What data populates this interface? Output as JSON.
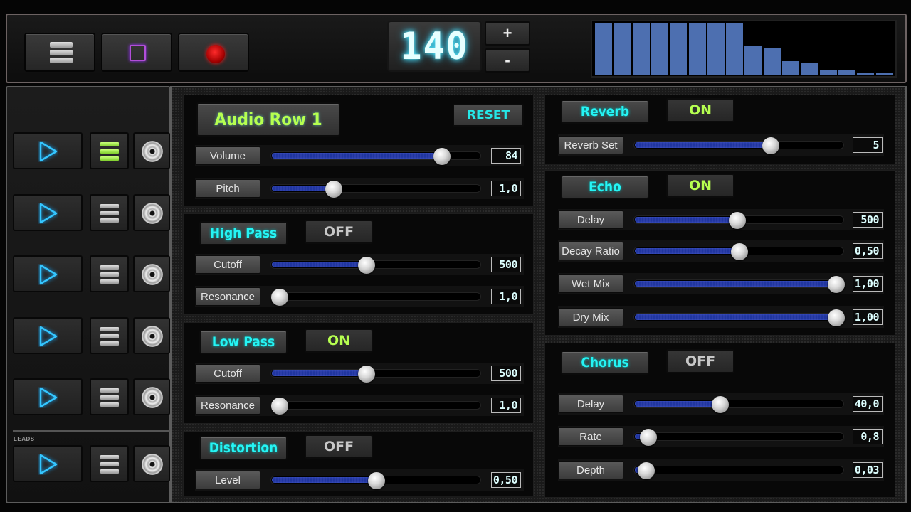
{
  "toolbar": {
    "menu_icon": "menu-bars-icon",
    "stop_icon": "stop-square-icon",
    "record_icon": "record-dot-icon",
    "bpm": "140",
    "bpm_plus": "+",
    "bpm_minus": "-"
  },
  "level_meter": {
    "levels": [
      1.0,
      1.0,
      1.0,
      1.0,
      1.0,
      1.0,
      1.0,
      1.0,
      0.57,
      0.52,
      0.26,
      0.23,
      0.1,
      0.08,
      0.02,
      0.02
    ],
    "color": "#4d6fb0"
  },
  "rows": [
    {
      "play_icon": "play-icon",
      "list_icon": "list-icon",
      "disc_icon": "disc-icon",
      "active": true
    },
    {
      "play_icon": "play-icon",
      "list_icon": "list-icon",
      "disc_icon": "disc-icon",
      "active": false
    },
    {
      "play_icon": "play-icon",
      "list_icon": "list-icon",
      "disc_icon": "disc-icon",
      "active": false
    },
    {
      "play_icon": "play-icon",
      "list_icon": "list-icon",
      "disc_icon": "disc-icon",
      "active": false
    },
    {
      "play_icon": "play-icon",
      "list_icon": "list-icon",
      "disc_icon": "disc-icon",
      "active": false
    },
    {
      "play_icon": "play-icon",
      "list_icon": "list-icon",
      "disc_icon": "disc-icon",
      "active": false
    }
  ],
  "leads_label": "LEADS",
  "audio_row": {
    "title": "Audio Row 1",
    "reset": "RESET",
    "volume": {
      "label": "Volume",
      "value": "84",
      "pos": 0.84
    },
    "pitch": {
      "label": "Pitch",
      "value": "1,0",
      "pos": 0.28
    }
  },
  "high_pass": {
    "title": "High Pass",
    "state": "OFF",
    "cutoff": {
      "label": "Cutoff",
      "value": "500",
      "pos": 0.45
    },
    "resonance": {
      "label": "Resonance",
      "value": "1,0",
      "pos": 0.0
    }
  },
  "low_pass": {
    "title": "Low Pass",
    "state": "ON",
    "cutoff": {
      "label": "Cutoff",
      "value": "500",
      "pos": 0.45
    },
    "resonance": {
      "label": "Resonance",
      "value": "1,0",
      "pos": 0.0
    }
  },
  "distortion": {
    "title": "Distortion",
    "state": "OFF",
    "level": {
      "label": "Level",
      "value": "0,50",
      "pos": 0.5
    }
  },
  "reverb": {
    "title": "Reverb",
    "state": "ON",
    "set": {
      "label": "Reverb Set",
      "value": "5",
      "pos": 0.66
    }
  },
  "echo": {
    "title": "Echo",
    "state": "ON",
    "delay": {
      "label": "Delay",
      "value": "500",
      "pos": 0.49
    },
    "decay": {
      "label": "Decay Ratio",
      "value": "0,50",
      "pos": 0.5
    },
    "wet": {
      "label": "Wet Mix",
      "value": "1,00",
      "pos": 1.0
    },
    "dry": {
      "label": "Dry Mix",
      "value": "1,00",
      "pos": 1.0
    }
  },
  "chorus": {
    "title": "Chorus",
    "state": "OFF",
    "delay": {
      "label": "Delay",
      "value": "40,0",
      "pos": 0.4
    },
    "rate": {
      "label": "Rate",
      "value": "0,8",
      "pos": 0.03
    },
    "depth": {
      "label": "Depth",
      "value": "0,03",
      "pos": 0.02
    }
  }
}
